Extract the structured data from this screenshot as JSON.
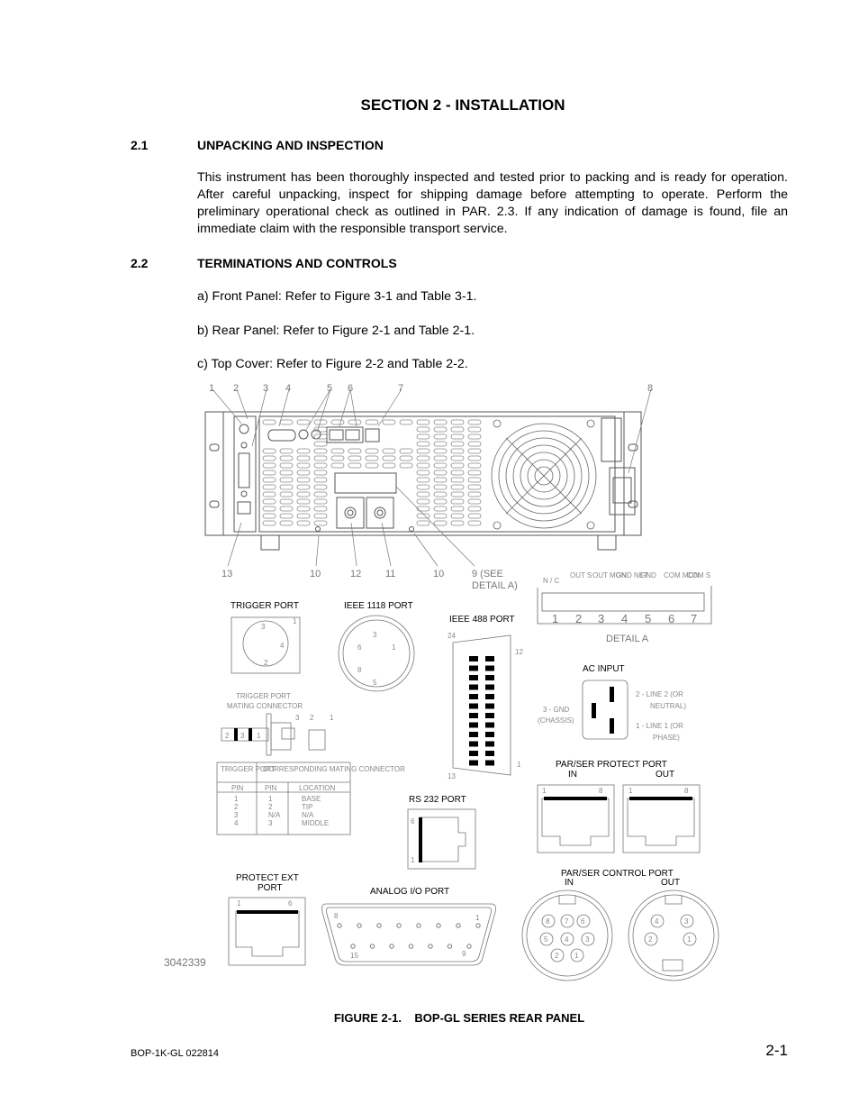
{
  "page": {
    "section_title": "SECTION 2 - INSTALLATION",
    "sections": [
      {
        "number": "2.1",
        "title": "UNPACKING AND INSPECTION",
        "paragraph": "This instrument has been thoroughly inspected and tested prior to packing and is ready for operation. After careful unpacking, inspect for shipping damage before attempting to operate. Perform the preliminary operational check as outlined in PAR. 2.3. If any indication of damage is found, file an immediate claim with the responsible transport service."
      },
      {
        "number": "2.2",
        "title": "TERMINATIONS AND CONTROLS",
        "items": [
          "a) Front Panel: Refer to Figure 3-1 and Table 3-1.",
          "b) Rear Panel: Refer to Figure 2-1 and Table 2-1.",
          "c) Top Cover: Refer to Figure 2-2 and Table 2-2."
        ]
      }
    ],
    "figure": {
      "callouts_top": [
        "1",
        "2",
        "3",
        "4",
        "5",
        "6",
        "7",
        "8"
      ],
      "callouts_bottom": [
        "13",
        "10",
        "12",
        "11",
        "10",
        "9 (SEE",
        "DETAIL A)"
      ],
      "detail_a": {
        "labels_top": [
          "N / C",
          "OUT S",
          "OUT MON",
          "GND NET",
          "GND",
          "COM MON",
          "COM S"
        ],
        "pins": [
          "1",
          "2",
          "3",
          "4",
          "5",
          "6",
          "7"
        ],
        "title": "DETAIL A"
      },
      "trigger_port": {
        "title": "TRIGGER PORT",
        "pins": [
          "1",
          "3",
          "4",
          "2"
        ]
      },
      "ieee1118_port": {
        "title": "IEEE 1118 PORT",
        "pins": [
          "3",
          "6",
          "1",
          "8",
          "5"
        ]
      },
      "ieee488_port": {
        "title": "IEEE 488 PORT",
        "pin_labels": [
          "24",
          "12",
          "13",
          "1"
        ]
      },
      "ac_input": {
        "title": "AC INPUT",
        "left_label": [
          "3 - GND",
          "(CHASSIS)"
        ],
        "right_top": [
          "2 - LINE 2 (OR",
          "NEUTRAL)"
        ],
        "right_bottom": [
          "1 - LINE 1 (OR",
          "PHASE)"
        ]
      },
      "trigger_mating": {
        "title": [
          "TRIGGER PORT",
          "MATING CONNECTOR"
        ],
        "plug_labels": [
          "2",
          "3",
          "1"
        ],
        "callouts": [
          "3",
          "2",
          "1"
        ]
      },
      "trigger_table": {
        "header1": [
          "TRIGGER PORT",
          "CORRESPONDING MATING CONNECTOR"
        ],
        "header2": [
          "PIN",
          "PIN",
          "LOCATION"
        ],
        "rows": [
          [
            "1",
            "1",
            "BASE"
          ],
          [
            "2",
            "2",
            "TIP"
          ],
          [
            "3",
            "N/A",
            "N/A"
          ],
          [
            "4",
            "3",
            "MIDDLE"
          ]
        ]
      },
      "par_ser_protect": {
        "title": "PAR/SER PROTECT PORT",
        "in": "IN",
        "out": "OUT",
        "pin_first": "1",
        "pin_last": "8"
      },
      "rs232_port": {
        "title": "RS 232 PORT",
        "pin_top": "6",
        "pin_bottom": "1"
      },
      "protect_ext": {
        "title": [
          "PROTECT EXT",
          "PORT"
        ],
        "pin_first": "1",
        "pin_last": "6"
      },
      "analog_io": {
        "title": "ANALOG I/O PORT",
        "pins": [
          "8",
          "1",
          "15",
          "9"
        ]
      },
      "par_ser_control": {
        "title": "PAR/SER CONTROL PORT",
        "in": "IN",
        "out": "OUT",
        "in_pins": [
          "8",
          "7",
          "6",
          "5",
          "4",
          "3",
          "2",
          "1"
        ],
        "out_pins": [
          "4",
          "3",
          "2",
          "1"
        ]
      },
      "drawing_number": "3042339"
    },
    "caption": "FIGURE 2-1.    BOP-GL SERIES REAR PANEL",
    "footer_left": "BOP-1K-GL 022814",
    "footer_right": "2-1"
  }
}
